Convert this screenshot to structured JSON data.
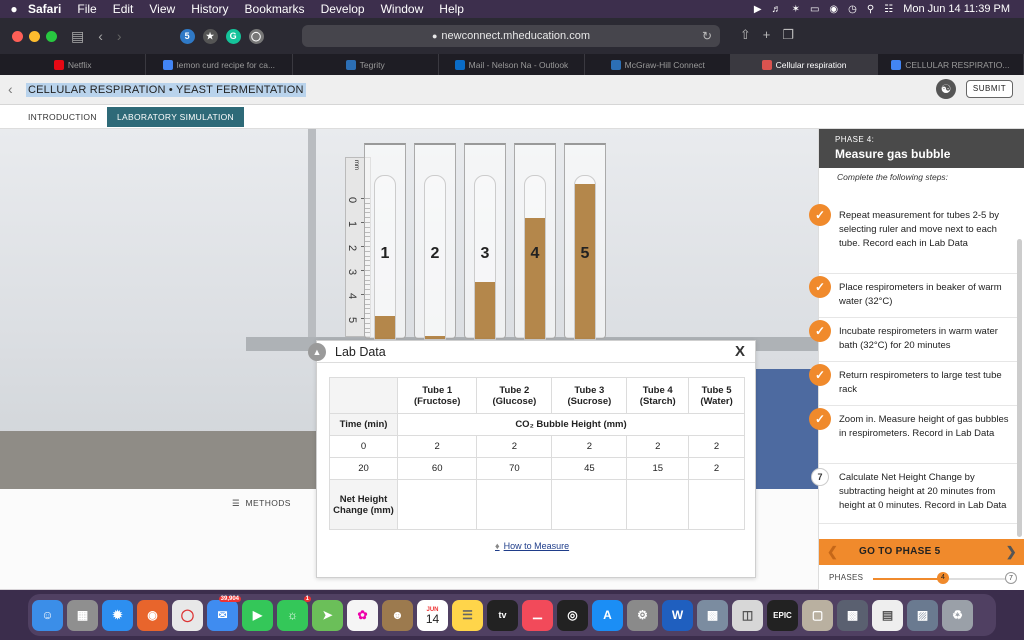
{
  "menubar": {
    "apple": "",
    "items": [
      "Safari",
      "File",
      "Edit",
      "View",
      "History",
      "Bookmarks",
      "Develop",
      "Window",
      "Help"
    ],
    "datetime": "Mon Jun 14  11:39 PM"
  },
  "browser": {
    "url": "newconnect.mheducation.com",
    "tabs": [
      {
        "label": "Netflix",
        "icon": "netflix-icon",
        "color": "#e50914"
      },
      {
        "label": "lemon curd recipe for ca...",
        "icon": "google-icon",
        "color": "#4285f4"
      },
      {
        "label": "Tegrity",
        "icon": "tegrity-icon",
        "color": "#2c6fb5"
      },
      {
        "label": "Mail - Nelson Na - Outlook",
        "icon": "outlook-icon",
        "color": "#0a6cc6"
      },
      {
        "label": "McGraw-Hill Connect",
        "icon": "mcgraw-hill-icon",
        "color": "#2c6fb5"
      },
      {
        "label": "Cellular respiration",
        "icon": "document-icon",
        "color": "#d9534f"
      },
      {
        "label": "CELLULAR RESPIRATIO...",
        "icon": "google-icon",
        "color": "#4285f4"
      }
    ],
    "active_tab": 5
  },
  "header": {
    "title": "CELLULAR RESPIRATION • YEAST FERMENTATION",
    "submit_label": "SUBMIT"
  },
  "subtabs": {
    "intro": "INTRODUCTION",
    "lab": "LABORATORY SIMULATION"
  },
  "scene": {
    "ruler_unit": "mm",
    "ruler_numbers": [
      "0",
      "1",
      "2",
      "3",
      "4",
      "5",
      "6"
    ],
    "tubes": [
      {
        "label": "1",
        "fill_fraction": 0.14
      },
      {
        "label": "2",
        "fill_fraction": 0.02
      },
      {
        "label": "3",
        "fill_fraction": 0.35
      },
      {
        "label": "4",
        "fill_fraction": 0.74
      },
      {
        "label": "5",
        "fill_fraction": 0.95
      }
    ]
  },
  "methods_label": "METHODS",
  "lab_data": {
    "title": "Lab Data",
    "close": "X",
    "columns": [
      {
        "name": "Tube 1",
        "sub": "(Fructose)"
      },
      {
        "name": "Tube 2",
        "sub": "(Glucose)"
      },
      {
        "name": "Tube 3",
        "sub": "(Sucrose)"
      },
      {
        "name": "Tube 4",
        "sub": "(Starch)"
      },
      {
        "name": "Tube 5",
        "sub": "(Water)"
      }
    ],
    "time_header": "Time (min)",
    "measure_header": "CO₂ Bubble Height (mm)",
    "rows": [
      {
        "time": "0",
        "values": [
          "2",
          "2",
          "2",
          "2",
          "2"
        ]
      },
      {
        "time": "20",
        "values": [
          "60",
          "70",
          "45",
          "15",
          "2"
        ]
      }
    ],
    "net_label": "Net Height Change (mm)",
    "net_values": [
      "",
      "",
      "",
      "",
      ""
    ],
    "how_to": "How to Measure"
  },
  "right_panel": {
    "phase": "PHASE 4:",
    "title": "Measure gas bubble",
    "instructions": "Complete the following steps:",
    "steps": [
      {
        "status": "done",
        "text": "Repeat measurement for tubes 2-5 by selecting ruler and move next to each tube. Record each in Lab Data"
      },
      {
        "status": "done",
        "text": "Place respirometers in beaker of warm water (32°C)"
      },
      {
        "status": "done",
        "text": "Incubate respirometers in warm water bath (32°C) for 20 minutes"
      },
      {
        "status": "done",
        "text": "Return respirometers to large test tube rack"
      },
      {
        "status": "done",
        "text": "Zoom in. Measure height of gas bubbles in respirometers. Record in Lab Data"
      },
      {
        "status": "pending",
        "number": "7",
        "text": "Calculate Net Height Change by subtracting height at 20 minutes from height at 0 minutes. Record in Lab Data"
      }
    ],
    "next_label": "GO TO PHASE 5",
    "phases_label": "PHASES",
    "current_phase": "4",
    "total_phases": "7",
    "progress": 0.5
  },
  "dock": {
    "mail_badge": "39,904",
    "messages_badge": "1",
    "calendar_month": "JUN",
    "calendar_day": "14",
    "tv_label": "tv",
    "epic_label": "EPIC"
  }
}
